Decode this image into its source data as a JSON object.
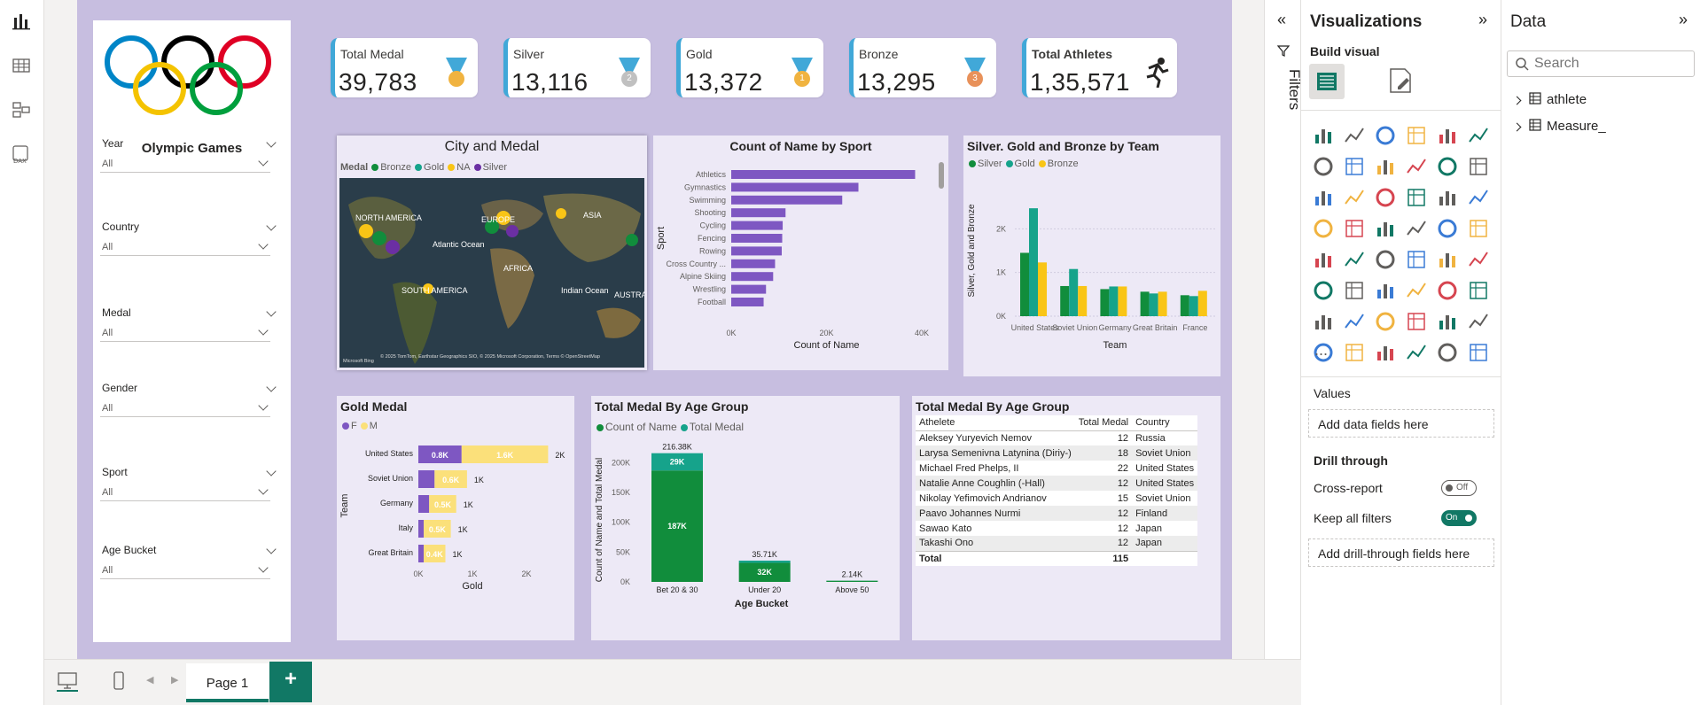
{
  "app": {
    "page_tab": "Page 1",
    "add_page": "+"
  },
  "kpis": [
    {
      "label": "Total Medal",
      "value": "39,783",
      "badge": ""
    },
    {
      "label": "Silver",
      "value": "13,116",
      "badge": "2"
    },
    {
      "label": "Gold",
      "value": "13,372",
      "badge": "1"
    },
    {
      "label": "Bronze",
      "value": "13,295",
      "badge": "3"
    },
    {
      "label": "Total Athletes",
      "value": "1,35,571",
      "badge": ""
    }
  ],
  "slicers": {
    "title": "Olympic Games",
    "items": [
      {
        "label": "Year",
        "value": "All"
      },
      {
        "label": "Country",
        "value": "All"
      },
      {
        "label": "Medal",
        "value": "All"
      },
      {
        "label": "Gender",
        "value": "All"
      },
      {
        "label": "Sport",
        "value": "All"
      },
      {
        "label": "Age Bucket",
        "value": "All"
      }
    ]
  },
  "map": {
    "title": "City and Medal",
    "legend_title": "Medal",
    "legend": [
      "Bronze",
      "Gold",
      "NA",
      "Silver"
    ],
    "legend_colors": [
      "#118d3c",
      "#16a38b",
      "#f9c516",
      "#6b2fa3"
    ],
    "labels": [
      "NORTH AMERICA",
      "EUROPE",
      "ASIA",
      "Atlantic Ocean",
      "AFRICA",
      "SOUTH AMERICA",
      "Indian Ocean",
      "AUSTRA"
    ],
    "attribution": "© 2025 TomTom, Earthstar Geographics SIO, © 2025 Microsoft Corporation, Terms © OpenStreetMap",
    "brand": "Microsoft Bing"
  },
  "colors": {
    "purple": "#7e57c2",
    "green": "#118d3c",
    "teal": "#16a38b",
    "yellow": "#f9c516",
    "canvas": "#c7bee0",
    "accent": "#117865"
  },
  "chart_data": [
    {
      "type": "bar",
      "title": "Count of Name by Sport",
      "xlabel": "Count of Name",
      "ylabel": "Sport",
      "categories": [
        "Athletics",
        "Gymnastics",
        "Swimming",
        "Shooting",
        "Cycling",
        "Fencing",
        "Rowing",
        "Cross Country ...",
        "Alpine Skiing",
        "Wrestling",
        "Football"
      ],
      "values": [
        38600,
        26700,
        23300,
        11400,
        10800,
        10700,
        10600,
        9200,
        8800,
        7300,
        6800
      ],
      "xlim": [
        0,
        40000
      ],
      "xticks": [
        "0K",
        "20K",
        "40K"
      ]
    },
    {
      "type": "bar",
      "title": "Silver. Gold and Bronze by Team",
      "xlabel": "Team",
      "ylabel": "Silver, Gold and Bronze",
      "categories": [
        "United States",
        "Soviet Union",
        "Germany",
        "Great Britain",
        "France"
      ],
      "series": [
        {
          "name": "Silver",
          "values": [
            1450,
            690,
            620,
            560,
            480
          ]
        },
        {
          "name": "Gold",
          "values": [
            2470,
            1080,
            680,
            520,
            460
          ]
        },
        {
          "name": "Bronze",
          "values": [
            1230,
            690,
            680,
            560,
            580
          ]
        }
      ],
      "ylim": [
        0,
        3000
      ],
      "yticks": [
        "0K",
        "1K",
        "2K"
      ]
    },
    {
      "type": "bar",
      "title": "Gold Medal",
      "xlabel": "Gold",
      "ylabel": "Team",
      "categories": [
        "United States",
        "Soviet Union",
        "Germany",
        "Italy",
        "Great Britain"
      ],
      "series": [
        {
          "name": "F",
          "values": [
            0.8,
            0.3,
            0.2,
            0.1,
            0.1
          ],
          "labels": [
            "0.8K",
            "",
            "",
            "",
            ""
          ]
        },
        {
          "name": "M",
          "values": [
            1.6,
            0.6,
            0.5,
            0.5,
            0.4
          ],
          "labels": [
            "1.6K",
            "0.6K",
            "0.5K",
            "0.5K",
            "0.4K"
          ]
        }
      ],
      "totals": [
        "2K",
        "1K",
        "1K",
        "1K",
        "1K"
      ],
      "xticks": [
        "0K",
        "1K",
        "2K"
      ],
      "xlim": [
        0,
        2.6
      ]
    },
    {
      "type": "bar",
      "title": "Total Medal By Age Group",
      "xlabel": "Age Bucket",
      "ylabel": "Count of Name and Total Medal",
      "categories": [
        "Bet 20 & 30",
        "Under 20",
        "Above 50"
      ],
      "series": [
        {
          "name": "Count of Name",
          "values": [
            187000,
            32000,
            2000
          ],
          "labels": [
            "187K",
            "32K",
            ""
          ]
        },
        {
          "name": "Total Medal",
          "values": [
            29000,
            3710,
            140
          ],
          "labels": [
            "29K",
            "",
            ""
          ]
        }
      ],
      "totals": [
        "216.38K",
        "35.71K",
        "2.14K"
      ],
      "ylim": [
        0,
        220000
      ],
      "yticks": [
        "0K",
        "50K",
        "100K",
        "150K",
        "200K"
      ]
    }
  ],
  "table": {
    "title": "Total Medal By Age Group",
    "headers": [
      "Athelete",
      "Total Medal",
      "Country"
    ],
    "rows": [
      [
        "Aleksey Yuryevich Nemov",
        "12",
        "Russia"
      ],
      [
        "Larysa Semenivna Latynina (Diriy-)",
        "18",
        "Soviet Union"
      ],
      [
        "Michael Fred Phelps, II",
        "22",
        "United States"
      ],
      [
        "Natalie Anne Coughlin (-Hall)",
        "12",
        "United States"
      ],
      [
        "Nikolay Yefimovich Andrianov",
        "15",
        "Soviet Union"
      ],
      [
        "Paavo Johannes Nurmi",
        "12",
        "Finland"
      ],
      [
        "Sawao Kato",
        "12",
        "Japan"
      ],
      [
        "Takashi Ono",
        "12",
        "Japan"
      ]
    ],
    "total": [
      "Total",
      "115",
      ""
    ]
  },
  "filters": {
    "label": "Filters"
  },
  "viz": {
    "title": "Visualizations",
    "build": "Build visual",
    "more": "...",
    "values_label": "Values",
    "add_fields": "Add data fields here",
    "drill": "Drill through",
    "cross": "Cross-report",
    "cross_state": "Off",
    "keep": "Keep all filters",
    "keep_state": "On",
    "add_drill": "Add drill-through fields here"
  },
  "data": {
    "title": "Data",
    "search_placeholder": "Search",
    "tables": [
      "athlete",
      "Measure_"
    ]
  }
}
